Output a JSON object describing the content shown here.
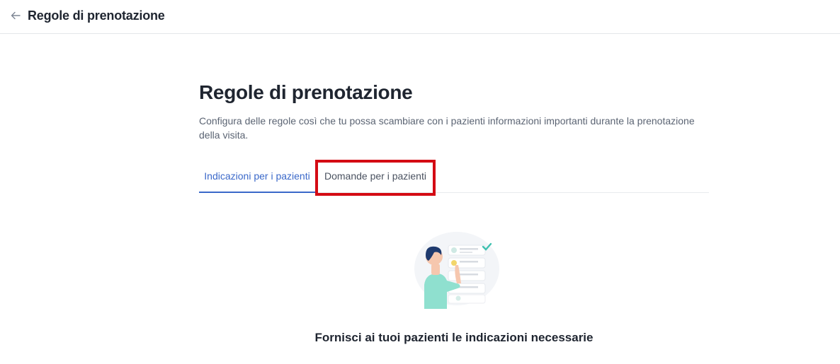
{
  "header": {
    "title": "Regole di prenotazione",
    "back_icon": "arrow-left-icon"
  },
  "main": {
    "title": "Regole di prenotazione",
    "description": "Configura delle regole così che tu possa scambiare con i pazienti informazioni importanti durante la prenotazione della visita.",
    "tabs": [
      {
        "label": "Indicazioni per i pazienti",
        "active": true
      },
      {
        "label": "Domande per i pazienti",
        "active": false
      }
    ],
    "empty_state": {
      "illustration": "doctor-checklist-illustration",
      "title": "Fornisci ai tuoi pazienti le indicazioni necessarie"
    }
  },
  "colors": {
    "accent": "#3a68c9",
    "highlight": "#d40b14",
    "text": "#1f2530",
    "muted": "#5b6473"
  }
}
